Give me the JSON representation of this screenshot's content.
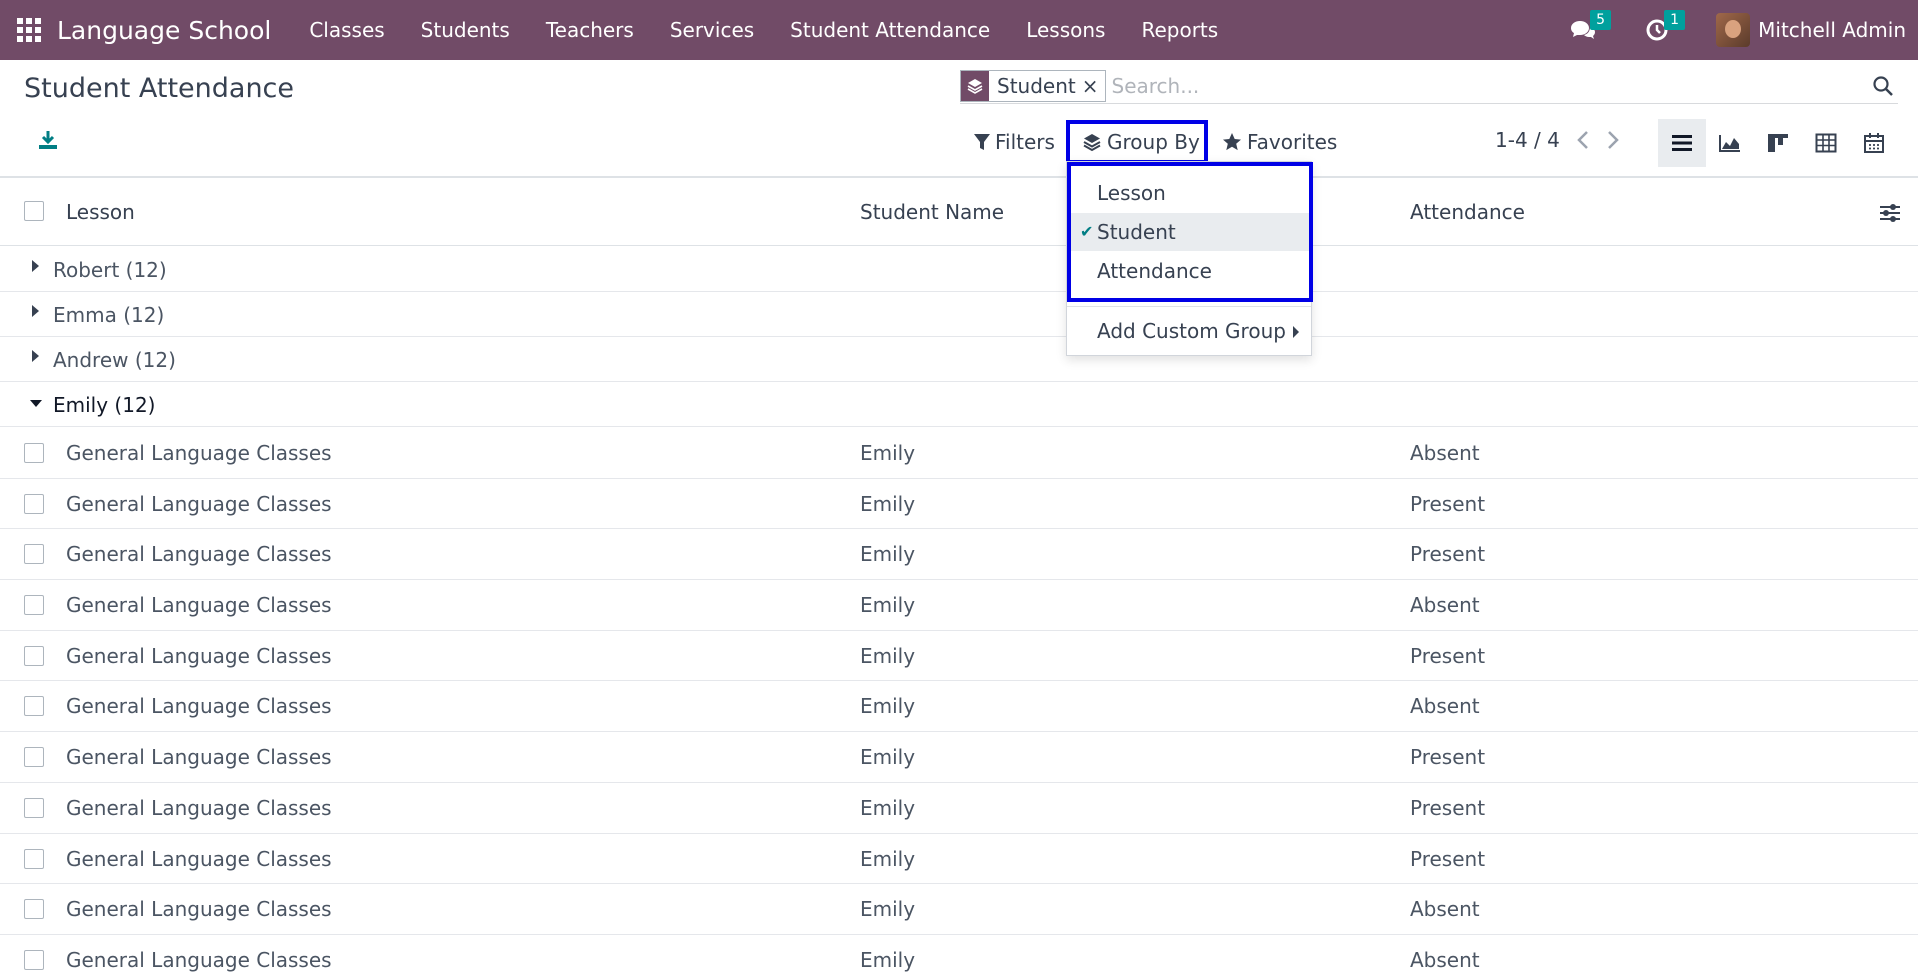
{
  "navbar": {
    "brand": "Language School",
    "menu": [
      "Classes",
      "Students",
      "Teachers",
      "Services",
      "Student Attendance",
      "Lessons",
      "Reports"
    ],
    "messages_count": "5",
    "activities_count": "1",
    "user_name": "Mitchell Admin"
  },
  "control_panel": {
    "title": "Student Attendance",
    "search": {
      "facet_label": "Student",
      "facet_close": "×",
      "placeholder": "Search..."
    },
    "filters_label": "Filters",
    "groupby_label": "Group By",
    "favorites_label": "Favorites",
    "pager": "1-4 / 4"
  },
  "groupby_dropdown": {
    "options": [
      {
        "label": "Lesson",
        "selected": false
      },
      {
        "label": "Student",
        "selected": true
      },
      {
        "label": "Attendance",
        "selected": false
      }
    ],
    "check_mark": "✔",
    "custom_group_label": "Add Custom Group"
  },
  "table": {
    "columns": [
      "Lesson",
      "Student Name",
      "Attendance"
    ],
    "groups": [
      {
        "label": "Robert (12)",
        "open": false
      },
      {
        "label": "Emma (12)",
        "open": false
      },
      {
        "label": "Andrew (12)",
        "open": false
      },
      {
        "label": "Emily (12)",
        "open": true
      }
    ],
    "rows": [
      {
        "lesson": "General Language Classes",
        "student": "Emily",
        "attendance": "Absent"
      },
      {
        "lesson": "General Language Classes",
        "student": "Emily",
        "attendance": "Present"
      },
      {
        "lesson": "General Language Classes",
        "student": "Emily",
        "attendance": "Present"
      },
      {
        "lesson": "General Language Classes",
        "student": "Emily",
        "attendance": "Absent"
      },
      {
        "lesson": "General Language Classes",
        "student": "Emily",
        "attendance": "Present"
      },
      {
        "lesson": "General Language Classes",
        "student": "Emily",
        "attendance": "Absent"
      },
      {
        "lesson": "General Language Classes",
        "student": "Emily",
        "attendance": "Present"
      },
      {
        "lesson": "General Language Classes",
        "student": "Emily",
        "attendance": "Present"
      },
      {
        "lesson": "General Language Classes",
        "student": "Emily",
        "attendance": "Present"
      },
      {
        "lesson": "General Language Classes",
        "student": "Emily",
        "attendance": "Absent"
      },
      {
        "lesson": "General Language Classes",
        "student": "Emily",
        "attendance": "Absent"
      }
    ]
  },
  "colors": {
    "navbar": "#714b67",
    "badge": "#00a09d",
    "highlight": "#0000e6"
  }
}
